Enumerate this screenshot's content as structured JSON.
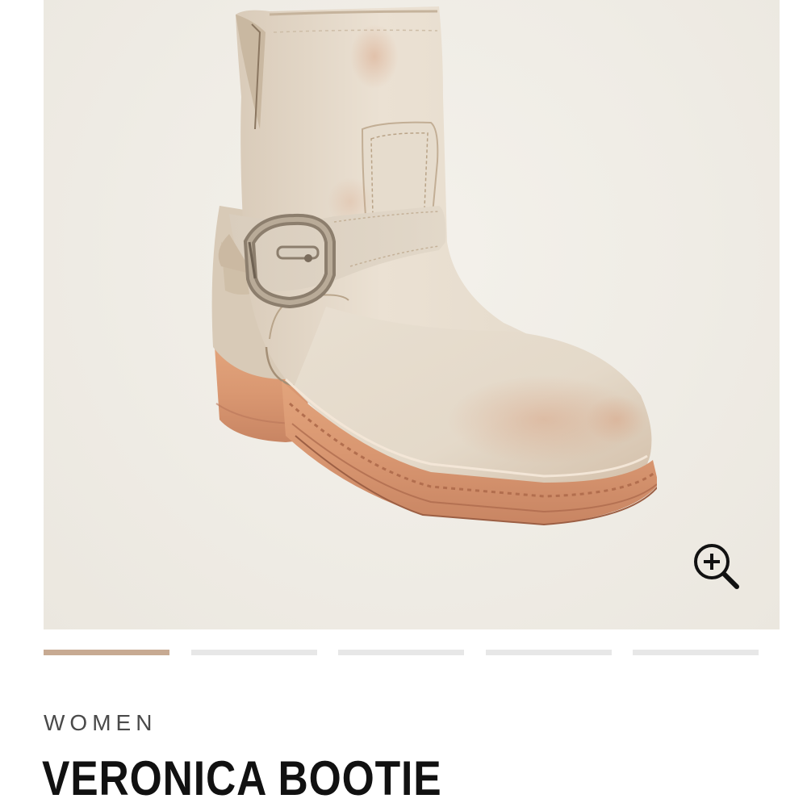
{
  "product": {
    "category": "WOMEN",
    "name": "VERONICA BOOTIE"
  },
  "gallery": {
    "image_alt": "boot-image",
    "zoom_icon": "zoom-in-icon",
    "background_color": "#efece5",
    "total_images": 5,
    "active_index": 0
  },
  "pager": {
    "active_color": "#c7aa92",
    "inactive_color": "#e7e7e7"
  }
}
